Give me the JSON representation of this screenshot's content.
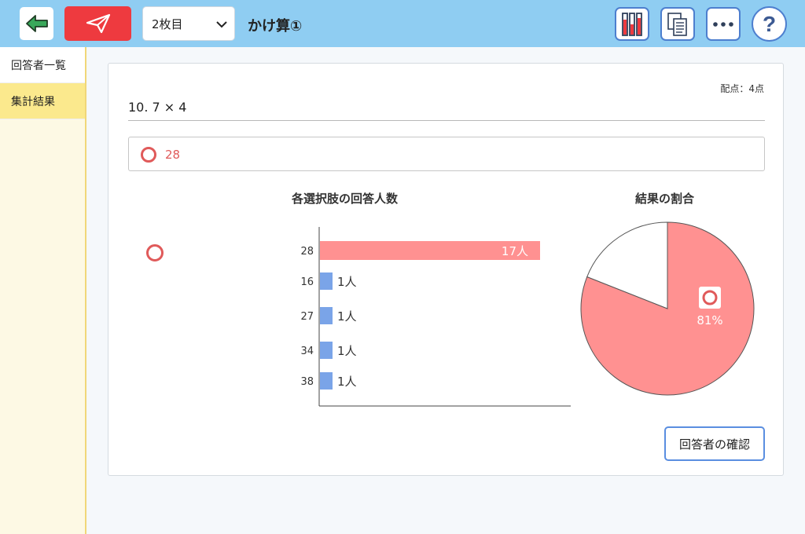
{
  "header": {
    "sheet_selected": "2枚目",
    "title": "かけ算①",
    "icons": [
      "back-arrow-icon",
      "paper-plane-icon",
      "chevron-down-icon",
      "bar-stats-icon",
      "copy-document-icon",
      "more-dots-icon",
      "help-icon"
    ],
    "help_label": "?"
  },
  "sidebar": {
    "items": [
      {
        "label": "回答者一覧",
        "active": false
      },
      {
        "label": "集計結果",
        "active": true
      }
    ]
  },
  "question": {
    "points_label": "配点：4点",
    "text": "10.  7 × 4",
    "correct_answer": "28"
  },
  "colors": {
    "correct": "#ff9191",
    "wrong": "#7aa4e8",
    "accent_red": "#e05a5a",
    "topbar": "#8fcdf2",
    "sidebar_active": "#fbe98d"
  },
  "chart_data": [
    {
      "type": "bar",
      "orientation": "horizontal",
      "title": "各選択肢の回答人数",
      "categories": [
        "28",
        "16",
        "27",
        "34",
        "38"
      ],
      "values": [
        17,
        1,
        1,
        1,
        1
      ],
      "value_labels": [
        "17人",
        "1人",
        "1人",
        "1人",
        "1人"
      ],
      "correct_category": "28"
    },
    {
      "type": "pie",
      "title": "結果の割合",
      "slices": [
        {
          "label": "correct",
          "value": 81
        },
        {
          "label": "incorrect",
          "value": 19
        }
      ],
      "correct_percent_label": "81%"
    }
  ],
  "footer": {
    "confirm_label": "回答者の確認"
  }
}
